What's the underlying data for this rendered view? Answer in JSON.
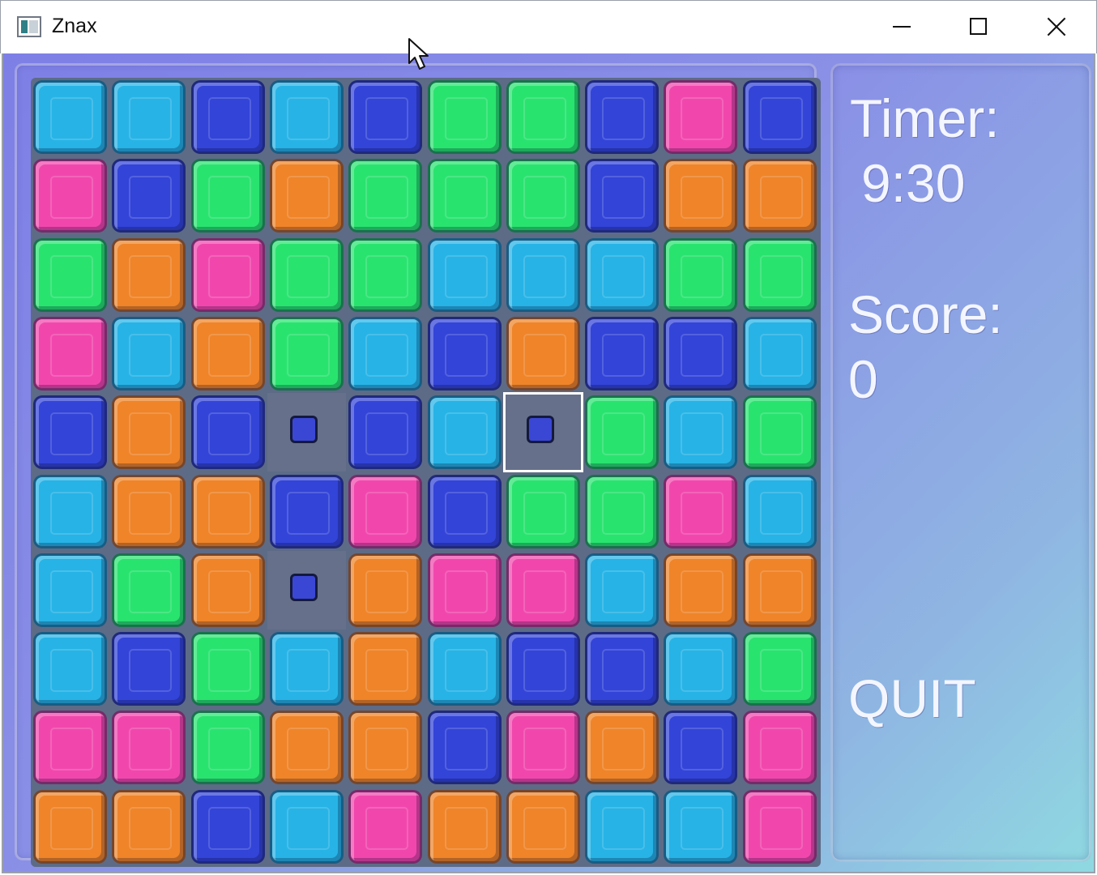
{
  "window": {
    "title": "Znax"
  },
  "panel": {
    "timer_label": "Timer:",
    "timer_value": "9:30",
    "score_label": "Score:",
    "score_value": "0",
    "quit_label": "QUIT"
  },
  "colors": {
    "cyan": "#27b3e6",
    "blue": "#3344d8",
    "green": "#29e36f",
    "orange": "#ef8429",
    "pink": "#f147ad",
    "empty": "#66708a"
  },
  "board": {
    "columns": 10,
    "rows": 10,
    "selected": {
      "row": 4,
      "col": 6
    },
    "grid": [
      [
        "cyan",
        "cyan",
        "blue",
        "cyan",
        "blue",
        "green",
        "green",
        "blue",
        "pink",
        "blue"
      ],
      [
        "pink",
        "blue",
        "green",
        "orange",
        "green",
        "green",
        "green",
        "blue",
        "orange",
        "orange"
      ],
      [
        "green",
        "orange",
        "pink",
        "green",
        "green",
        "cyan",
        "cyan",
        "cyan",
        "green",
        "green"
      ],
      [
        "pink",
        "cyan",
        "orange",
        "green",
        "cyan",
        "blue",
        "orange",
        "blue",
        "blue",
        "cyan"
      ],
      [
        "blue",
        "orange",
        "blue",
        "empty",
        "blue",
        "cyan",
        "empty",
        "green",
        "cyan",
        "green"
      ],
      [
        "cyan",
        "orange",
        "orange",
        "blue",
        "pink",
        "blue",
        "green",
        "green",
        "pink",
        "cyan"
      ],
      [
        "cyan",
        "green",
        "orange",
        "empty",
        "orange",
        "pink",
        "pink",
        "cyan",
        "orange",
        "orange"
      ],
      [
        "cyan",
        "blue",
        "green",
        "cyan",
        "orange",
        "cyan",
        "blue",
        "blue",
        "cyan",
        "green"
      ],
      [
        "pink",
        "pink",
        "green",
        "orange",
        "orange",
        "blue",
        "pink",
        "orange",
        "blue",
        "pink"
      ],
      [
        "orange",
        "orange",
        "blue",
        "cyan",
        "pink",
        "orange",
        "orange",
        "cyan",
        "cyan",
        "pink"
      ]
    ]
  }
}
